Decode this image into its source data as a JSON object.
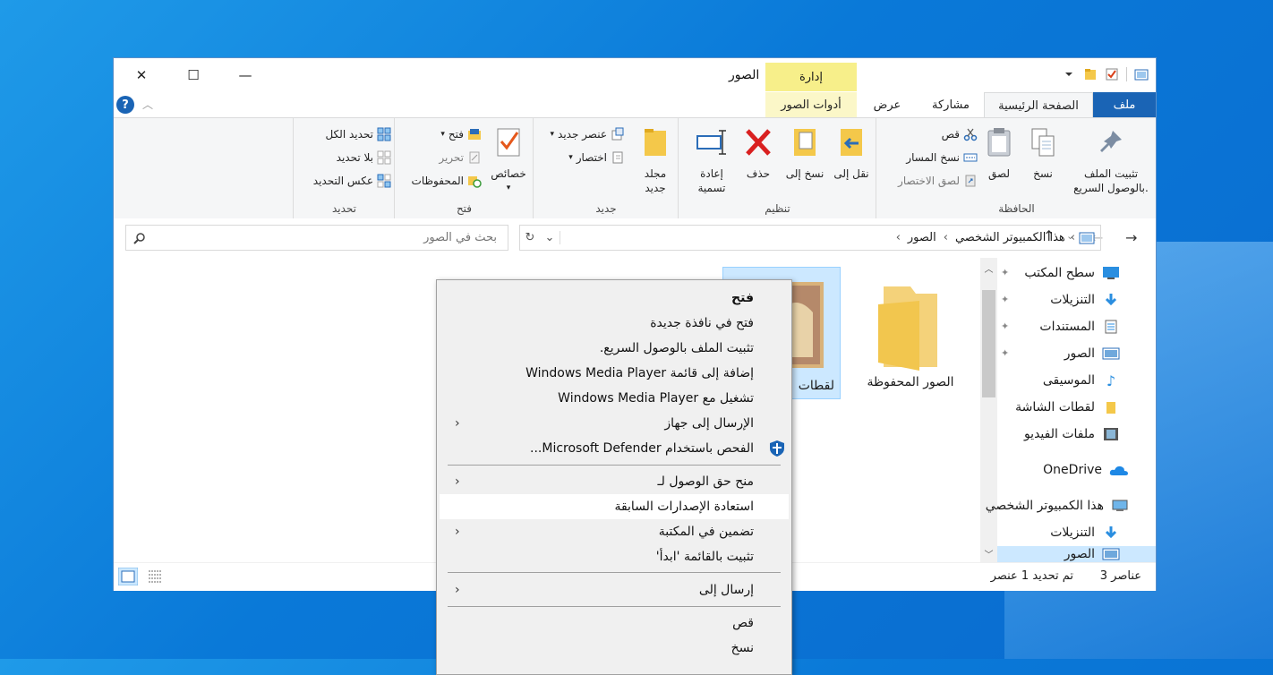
{
  "window": {
    "title": "الصور",
    "manage_label": "إدارة",
    "caption": {
      "close": "✕",
      "maximize": "☐",
      "minimize": "—"
    }
  },
  "tabs": {
    "file": "ملف",
    "home": "الصفحة الرئيسية",
    "share": "مشاركة",
    "view": "عرض",
    "picture_tools": "أدوات الصور"
  },
  "ribbon": {
    "clipboard": {
      "label": "الحافظة",
      "pin": "تثبيت الملف بالوصول السريع.",
      "copy": "نسخ",
      "paste": "لصق",
      "cut": "قص",
      "copy_path": "نسخ المسار",
      "paste_shortcut": "لصق الاختصار"
    },
    "organize": {
      "label": "تنظيم",
      "move_to": "نقل إلى",
      "copy_to": "نسخ إلى",
      "delete": "حذف",
      "rename": "إعادة تسمية"
    },
    "new": {
      "label": "جديد",
      "new_folder": "مجلد جديد",
      "new_item": "عنصر جديد",
      "easy_access": "اختصار"
    },
    "open": {
      "label": "فتح",
      "properties": "خصائص",
      "open": "فتح",
      "edit": "تحرير",
      "history": "المحفوظات"
    },
    "select": {
      "label": "تحديد",
      "select_all": "تحديد الكل",
      "select_none": "بلا تحديد",
      "invert": "عكس التحديد"
    }
  },
  "address": {
    "crumbs": [
      "هذا الكمبيوتر الشخصي",
      "الصور"
    ],
    "search_placeholder": "بحث في الصور"
  },
  "navpane": {
    "items": [
      {
        "label": "سطح المكتب",
        "icon": "desktop-icon",
        "pinned": true
      },
      {
        "label": "التنزيلات",
        "icon": "download-icon",
        "pinned": true
      },
      {
        "label": "المستندات",
        "icon": "documents-icon",
        "pinned": true
      },
      {
        "label": "الصور",
        "icon": "pictures-icon",
        "pinned": true
      },
      {
        "label": "الموسيقى",
        "icon": "music-icon",
        "pinned": false
      },
      {
        "label": "لقطات الشاشة",
        "icon": "folder-icon",
        "pinned": false
      },
      {
        "label": "ملفات الفيديو",
        "icon": "video-icon",
        "pinned": false
      },
      {
        "label": "OneDrive",
        "icon": "onedrive-icon",
        "pinned": false
      },
      {
        "label": "هذا الكمبيوتر الشخصي",
        "icon": "computer-icon",
        "pinned": false
      },
      {
        "label": "التنزيلات",
        "icon": "download-icon",
        "pinned": false
      },
      {
        "label": "الصور",
        "icon": "pictures-icon",
        "pinned": false
      }
    ]
  },
  "content": {
    "items": [
      {
        "label": "الصور المحفوظة"
      },
      {
        "label": "لقطات"
      }
    ]
  },
  "status": {
    "count": "3 عناصر",
    "selected": "تم تحديد 1 عنصر"
  },
  "context_menu": {
    "items": [
      {
        "label": "فتح",
        "bold": true
      },
      {
        "label": "فتح في نافذة جديدة"
      },
      {
        "label": "تثبيت الملف بالوصول السريع."
      },
      {
        "label": "إضافة إلى قائمة Windows Media Player"
      },
      {
        "label": "تشغيل مع Windows Media Player"
      },
      {
        "label": "الإرسال إلى جهاز",
        "submenu": true
      },
      {
        "label": "الفحص باستخدام Microsoft Defender..."
      },
      {
        "label": "منح حق الوصول لـ",
        "submenu": true
      },
      {
        "label": "استعادة الإصدارات السابقة",
        "highlighted": true
      },
      {
        "label": "تضمين في المكتبة",
        "submenu": true
      },
      {
        "label": "تثبيت بالقائمة 'ابدأ'"
      },
      {
        "label": "إرسال إلى",
        "submenu": true
      },
      {
        "label": "قص"
      },
      {
        "label": "نسخ"
      }
    ]
  }
}
